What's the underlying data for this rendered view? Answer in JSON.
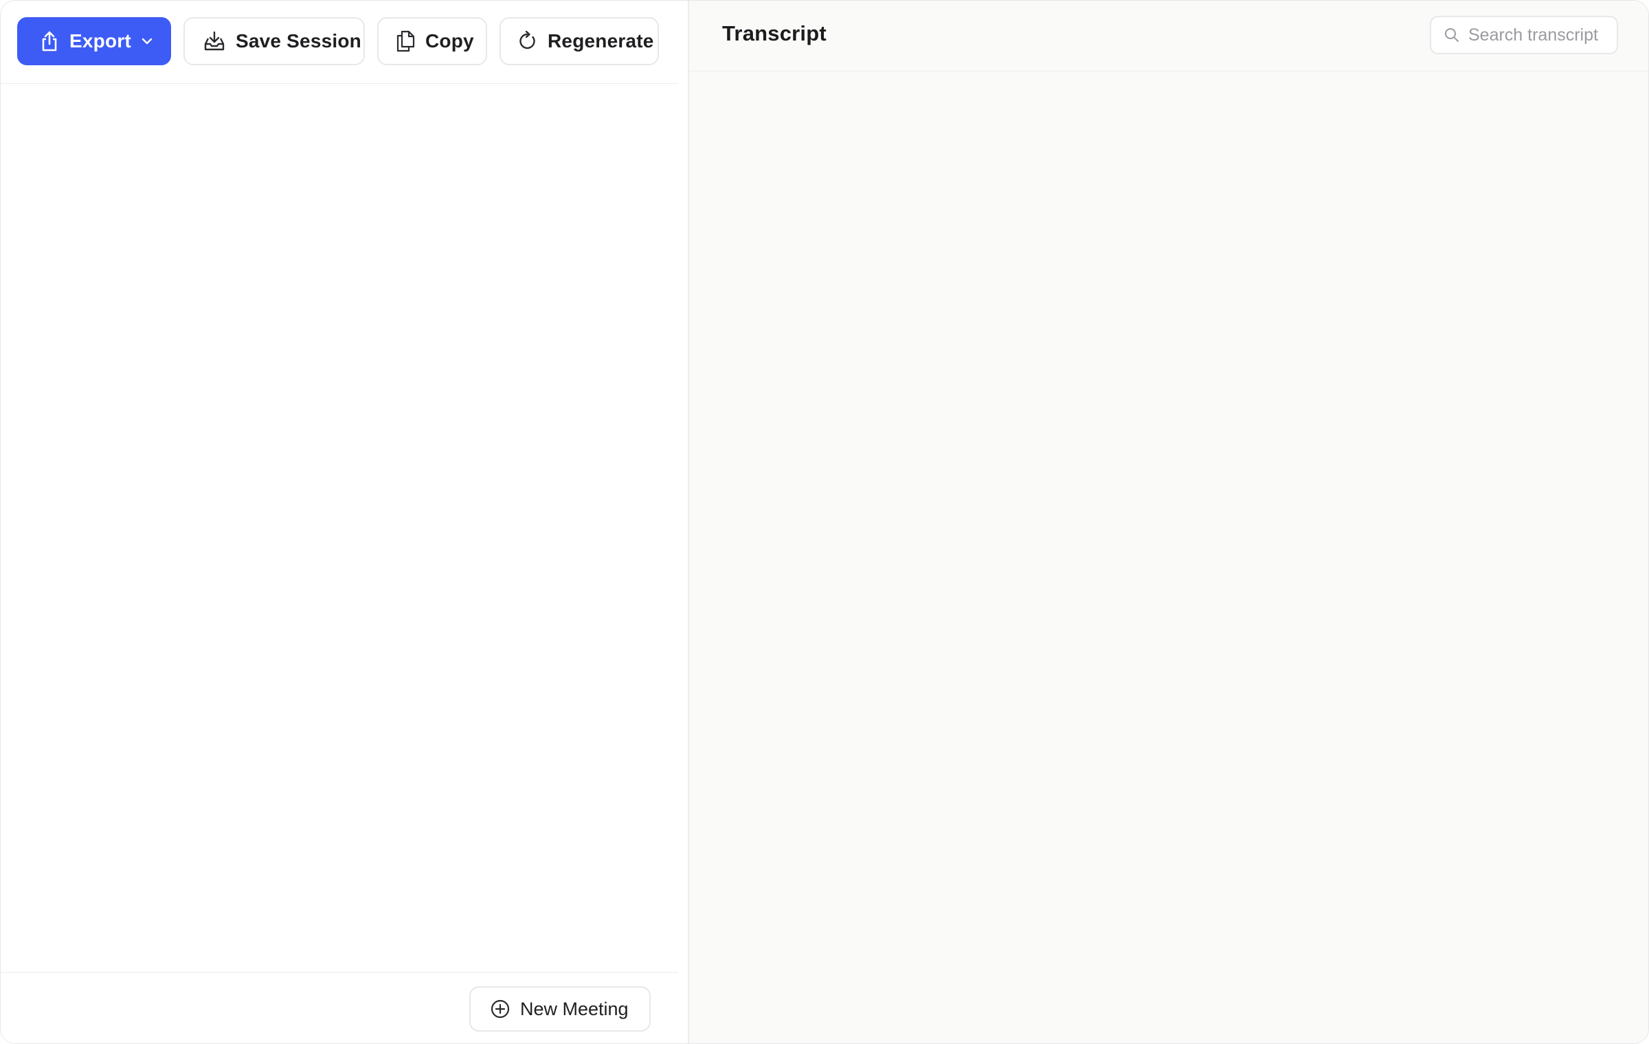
{
  "toolbar": {
    "export_label": "Export",
    "save_session_label": "Save Session",
    "copy_label": "Copy",
    "regenerate_label": "Regenerate"
  },
  "footer": {
    "new_meeting_label": "New Meeting"
  },
  "transcript": {
    "title": "Transcript",
    "search_placeholder": "Search transcript",
    "search_value": ""
  },
  "icons": {
    "export": "share-upload-icon",
    "export_menu": "chevron-down-icon",
    "save_session": "inbox-download-icon",
    "copy": "copy-documents-icon",
    "regenerate": "refresh-icon",
    "new_meeting": "plus-circle-icon",
    "search": "search-icon"
  },
  "colors": {
    "accent": "#3d5cf5",
    "border": "#e8e8ea",
    "right_pane_bg": "#fafaf9"
  }
}
